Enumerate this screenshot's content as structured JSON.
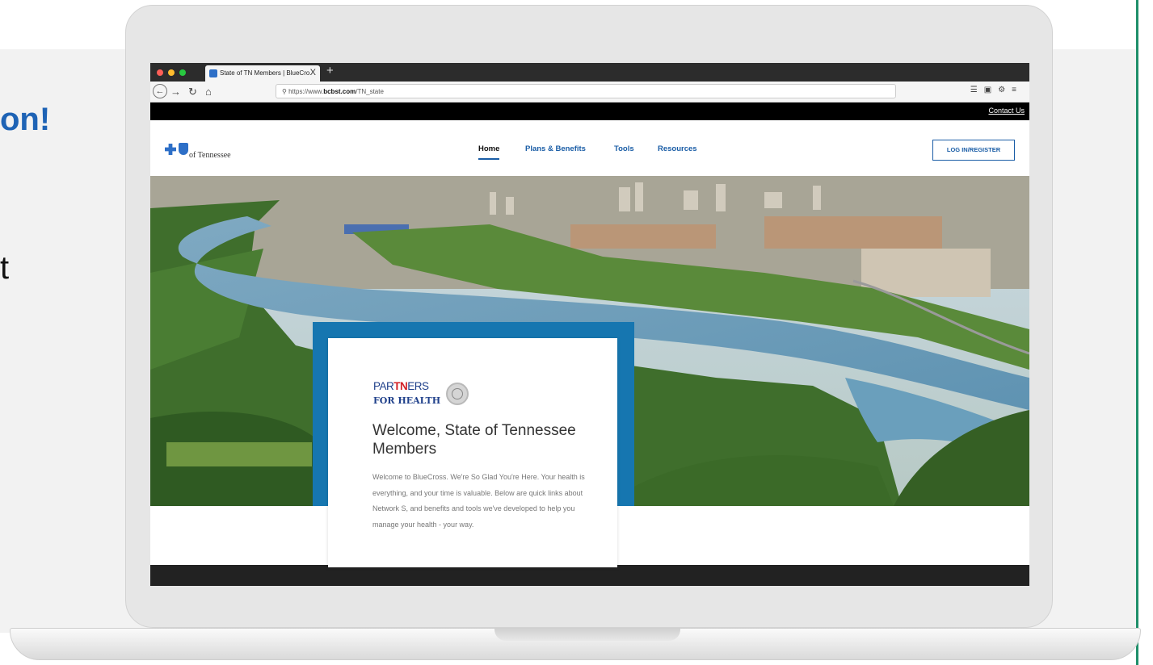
{
  "slide": {
    "heading_fragment": "on!",
    "text_fragment": "t"
  },
  "browser": {
    "tab_title": "State of TN Members | BlueCro",
    "tab_close": "X",
    "new_tab": "+",
    "url_prefix": "https://www.",
    "url_domain": "bcbst.com",
    "url_path": "/TN_state"
  },
  "page": {
    "contact_link": "Contact Us",
    "logo_text": "of Tennessee",
    "nav": {
      "home": "Home",
      "plans": "Plans & Benefits",
      "tools": "Tools",
      "resources": "Resources"
    },
    "login_button": "LOG IN/REGISTER",
    "hero": {
      "partners_part1": "PAR",
      "partners_tn": "TN",
      "partners_part2": "ERS",
      "for_health": "FOR HEALTH",
      "title": "Welcome, State of Tennessee Members",
      "body": "Welcome to BlueCross. We're So Glad You're Here. Your health is everything, and your time is valuable. Below are quick links about Network S, and benefits and tools we've developed to help you manage your health - your way."
    }
  },
  "colors": {
    "brand_blue": "#1a5da6",
    "hero_frame": "#1676b0",
    "accent_green": "#1f8f6a",
    "tn_red": "#d21f26"
  }
}
